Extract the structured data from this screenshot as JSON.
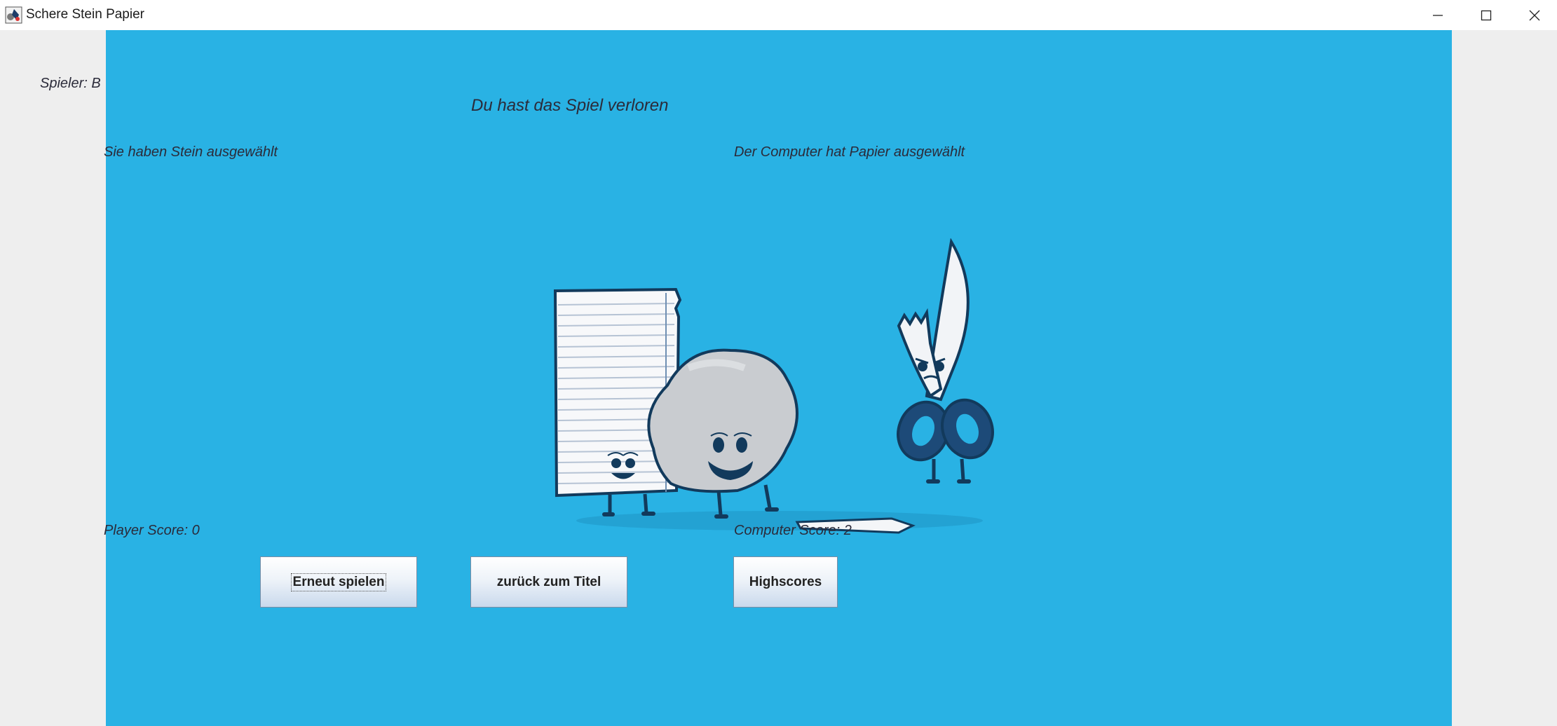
{
  "window": {
    "title": "Schere Stein Papier"
  },
  "game": {
    "player_label": "Spieler: B",
    "result": "Du hast das Spiel verloren",
    "player_choice": "Sie haben Stein ausgewählt",
    "computer_choice": "Der Computer hat Papier ausgewählt",
    "player_score": "Player Score: 0",
    "computer_score": "Computer Score: 2"
  },
  "buttons": {
    "replay": "Erneut spielen",
    "back": "zurück zum Titel",
    "highscores": "Highscores"
  },
  "colors": {
    "panel": "#29b2e4",
    "background": "#eeeeee",
    "text": "#2b2b3a",
    "ink": "#123a5c"
  },
  "icons": {
    "app": "scissors-stone-paper-icon",
    "minimize": "minimize-icon",
    "maximize": "maximize-icon",
    "close": "close-icon"
  }
}
